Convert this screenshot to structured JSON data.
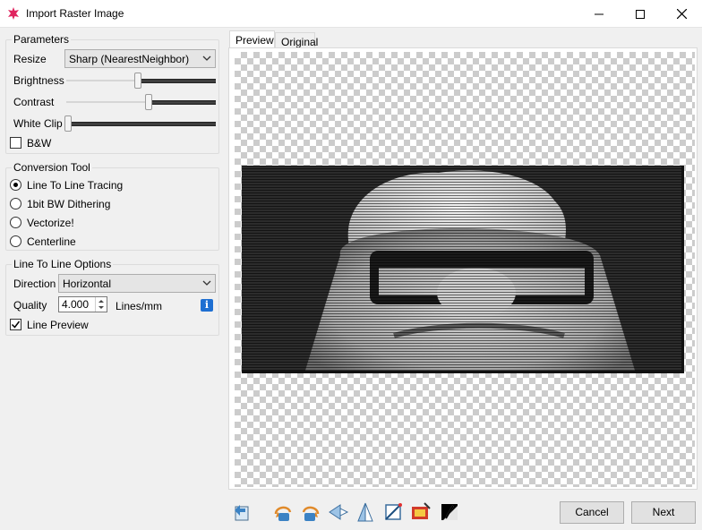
{
  "window": {
    "title": "Import Raster Image"
  },
  "parameters": {
    "title": "Parameters",
    "resize_label": "Resize",
    "resize_value": "Sharp (NearestNeighbor)",
    "brightness_label": "Brightness",
    "brightness_value": 0.5,
    "contrast_label": "Contrast",
    "contrast_value": 0.55,
    "white_clip_label": "White Clip",
    "white_clip_value": 0.0,
    "bw_label": "B&W",
    "bw_checked": false
  },
  "conversion": {
    "title": "Conversion Tool",
    "options": [
      "Line To Line Tracing",
      "1bit BW Dithering",
      "Vectorize!",
      "Centerline"
    ],
    "selected": "Line To Line Tracing"
  },
  "line_options": {
    "title": "Line To Line Options",
    "direction_label": "Direction",
    "direction_value": "Horizontal",
    "quality_label": "Quality",
    "quality_value": "4.000",
    "quality_unit": "Lines/mm",
    "line_preview_label": "Line Preview",
    "line_preview_checked": true
  },
  "tabs": [
    {
      "label": "Preview",
      "active": true
    },
    {
      "label": "Original",
      "active": false
    }
  ],
  "toolbar_icons": [
    "reset-icon",
    "rotate-left-icon",
    "rotate-right-icon",
    "flip-horizontal-icon",
    "flip-vertical-icon",
    "crop-icon",
    "auto-trim-icon",
    "invert-icon"
  ],
  "buttons": {
    "cancel": "Cancel",
    "next": "Next"
  },
  "colors": {
    "accent": "#1e6fd2",
    "app_icon": "#e0245e"
  }
}
